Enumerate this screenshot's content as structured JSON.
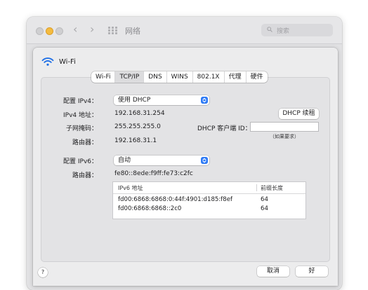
{
  "parent_window": {
    "title": "网络",
    "search_placeholder": "搜索"
  },
  "sheet": {
    "title": "Wi-Fi",
    "tabs": [
      {
        "label": "Wi-Fi",
        "selected": false
      },
      {
        "label": "TCP/IP",
        "selected": true
      },
      {
        "label": "DNS",
        "selected": false
      },
      {
        "label": "WINS",
        "selected": false
      },
      {
        "label": "802.1X",
        "selected": false
      },
      {
        "label": "代理",
        "selected": false
      },
      {
        "label": "硬件",
        "selected": false
      }
    ],
    "ipv4": {
      "config_label": "配置 IPv4：",
      "config_value": "使用 DHCP",
      "address_label": "IPv4 地址：",
      "address_value": "192.168.31.254",
      "renew_button": "DHCP 续租",
      "subnet_label": "子网掩码：",
      "subnet_value": "255.255.255.0",
      "client_id_label": "DHCP 客户端 ID：",
      "client_id_value": "",
      "client_id_hint": "（如果要求）",
      "router_label": "路由器：",
      "router_value": "192.168.31.1"
    },
    "ipv6": {
      "config_label": "配置 IPv6：",
      "config_value": "自动",
      "router_label": "路由器：",
      "router_value": "fe80::8ede:f9ff:fe73:c2fc",
      "table": {
        "columns": [
          "IPv6 地址",
          "前缀长度"
        ],
        "rows": [
          [
            "fd00:6868:6868:0:44f:4901:d185:f8ef",
            "64"
          ],
          [
            "fd00:6868:6868::2c0",
            "64"
          ]
        ]
      }
    },
    "buttons": {
      "help": "?",
      "cancel": "取消",
      "ok": "好"
    }
  },
  "colors": {
    "accent": "#2f7bf6",
    "window_bg": "#ececed",
    "panel_bg": "#e3e3e5"
  }
}
